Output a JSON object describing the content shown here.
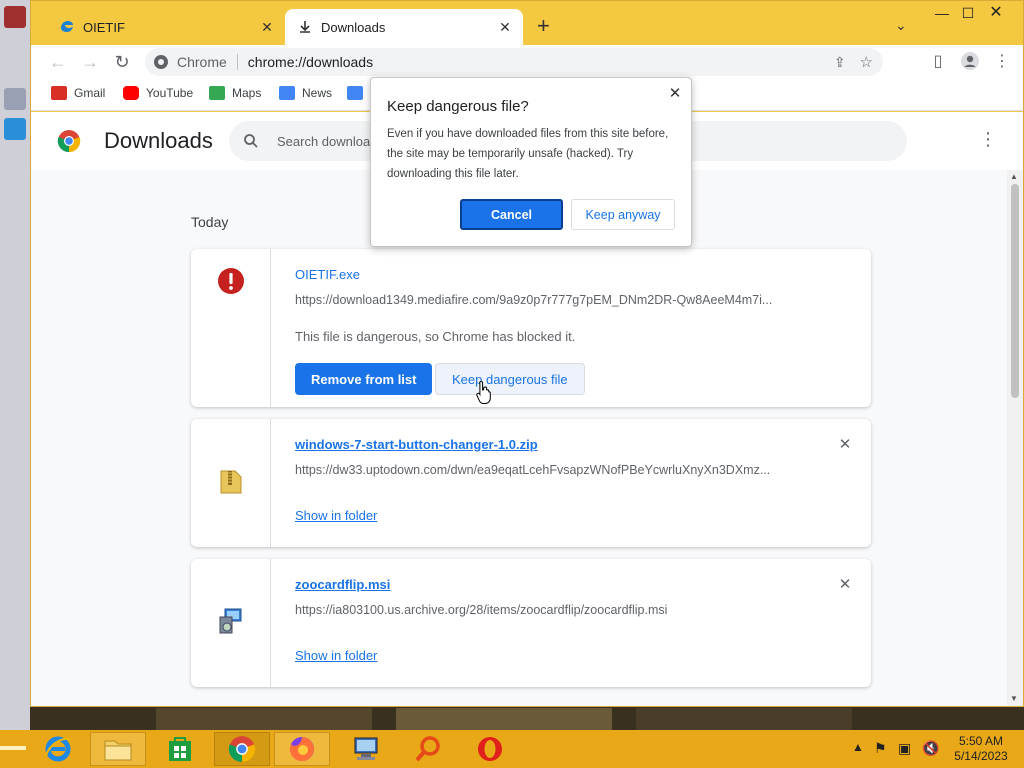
{
  "browser": {
    "tabs": [
      {
        "title": "OIETIF",
        "active": false
      },
      {
        "title": "Downloads",
        "active": true
      }
    ],
    "new_tab": "+",
    "window_controls": {
      "minimize": "—",
      "maximize": "☐",
      "close": "✕"
    },
    "omnibox": {
      "origin": "Chrome",
      "url": "chrome://downloads"
    },
    "bookmarks": [
      {
        "label": "Gmail",
        "color": "#d93025"
      },
      {
        "label": "YouTube",
        "color": "#ff0000"
      },
      {
        "label": "Maps",
        "color": "#34a853"
      },
      {
        "label": "News",
        "color": "#4285f4"
      }
    ]
  },
  "downloads": {
    "title": "Downloads",
    "search_placeholder": "Search downloads",
    "section_label": "Today",
    "items": [
      {
        "name": "OIETIF.exe",
        "url": "https://download1349.mediafire.com/9a9z0p7r777g7pEM_DNm2DR-Qw8AeeM4m7i...",
        "status": "This file is dangerous, so Chrome has blocked it.",
        "primary_action": "Remove from list",
        "secondary_action": "Keep dangerous file"
      },
      {
        "name": "windows-7-start-button-changer-1.0.zip",
        "url": "https://dw33.uptodown.com/dwn/ea9eqatLcehFvsapzWNofPBeYcwrluXnyXn3DXmz...",
        "action": "Show in folder"
      },
      {
        "name": "zoocardflip.msi",
        "url": "https://ia803100.us.archive.org/28/items/zoocardflip/zoocardflip.msi",
        "action": "Show in folder"
      }
    ]
  },
  "dialog": {
    "title": "Keep dangerous file?",
    "body": "Even if you have downloaded files from this site before, the site may be temporarily unsafe (hacked). Try downloading this file later.",
    "cancel_label": "Cancel",
    "keep_label": "Keep anyway"
  },
  "taskbar": {
    "time": "5:50 AM",
    "date": "5/14/2023"
  },
  "colors": {
    "accent": "#1a73e8",
    "danger": "#c5221f",
    "taskbar": "#e8a817",
    "tabstrip": "#f5c842"
  }
}
